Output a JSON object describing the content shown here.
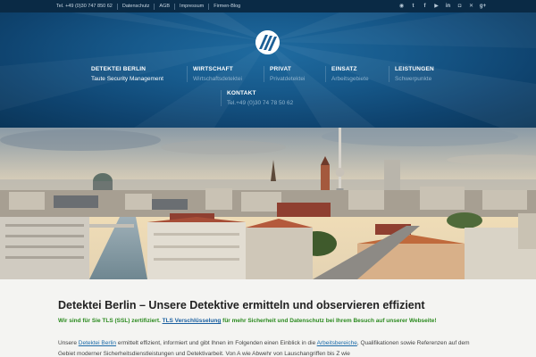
{
  "topbar": {
    "links": [
      "Tel. +49 (0)30 747 850 62",
      "Datenschutz",
      "AGB",
      "Impressum",
      "Firmen-Blog"
    ],
    "socials": [
      {
        "icon": "rss-icon",
        "glyph": "◉"
      },
      {
        "icon": "twitter-icon",
        "glyph": "t"
      },
      {
        "icon": "facebook-icon",
        "glyph": "f"
      },
      {
        "icon": "youtube-icon",
        "glyph": "▶"
      },
      {
        "icon": "linkedin-icon",
        "glyph": "in"
      },
      {
        "icon": "instagram-icon",
        "glyph": "◘"
      },
      {
        "icon": "xing-icon",
        "glyph": "✕"
      },
      {
        "icon": "google-plus-icon",
        "glyph": "g+"
      }
    ]
  },
  "nav": {
    "items": [
      {
        "title": "DETEKTEI BERLIN",
        "sub": "Taute Security Management"
      },
      {
        "title": "WIRTSCHAFT",
        "sub": "Wirtschaftsdetektei"
      },
      {
        "title": "PRIVAT",
        "sub": "Privatdetektei"
      },
      {
        "title": "EINSATZ",
        "sub": "Arbeitsgebiete"
      },
      {
        "title": "LEISTUNGEN",
        "sub": "Schwerpunkte"
      },
      {
        "title": "KONTAKT",
        "sub": "Tel.+49 (0)30 74 78 50 62"
      }
    ]
  },
  "content": {
    "heading": "Detektei Berlin – Unsere Detektive ermitteln und observieren effizient",
    "ssl": {
      "part1": "Wir sind für Sie TLS (SSL) zertifiziert. ",
      "link1": "TLS Verschlüsselung",
      "part2": " für mehr ",
      "bold2": "Sicherheit und Datenschutz",
      "part3": " bei Ihrem Besuch auf unserer Webseite!"
    },
    "para": {
      "p1": "Unsere ",
      "link1": "Detektei Berlin",
      "p2": " ermittelt effizient, informiert und gibt Ihnen im Folgenden einen Einblick in die ",
      "link2": "Arbeitsbereiche",
      "p3": ", Qualifikationen sowie Referenzen auf dem Gebiet moderner Sicherheitsdienstleistungen und Detektivarbeit. Von A wie Abwehr von Lauschangriffen bis Z wie"
    }
  },
  "colors": {
    "topbar": "#0a2a45",
    "header": "#175a8c",
    "ssl_green": "#2a8a1e",
    "link_blue": "#1a6aa8"
  }
}
